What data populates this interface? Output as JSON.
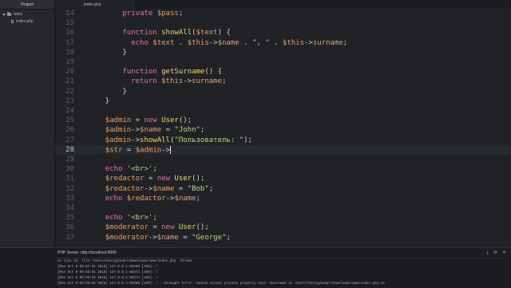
{
  "sidebar": {
    "title": "Project",
    "items": [
      {
        "label": "www",
        "type": "folder"
      },
      {
        "label": "index.php",
        "type": "file"
      }
    ]
  },
  "tabs": [
    {
      "label": "index.php"
    }
  ],
  "editor": {
    "current_line": 28,
    "lines": [
      {
        "num": "14",
        "tokens": [
          [
            "        ",
            "op"
          ],
          [
            "private",
            "kw"
          ],
          [
            " ",
            "op"
          ],
          [
            "$pass",
            "var"
          ],
          [
            ";",
            "op"
          ]
        ]
      },
      {
        "num": "15",
        "tokens": []
      },
      {
        "num": "16",
        "tokens": [
          [
            "        ",
            "op"
          ],
          [
            "function",
            "kw"
          ],
          [
            " ",
            "op"
          ],
          [
            "showAll",
            "fn"
          ],
          [
            "(",
            "op"
          ],
          [
            "$text",
            "var"
          ],
          [
            ") {",
            "op"
          ]
        ]
      },
      {
        "num": "17",
        "tokens": [
          [
            "          ",
            "op"
          ],
          [
            "echo",
            "kw"
          ],
          [
            " ",
            "op"
          ],
          [
            "$text",
            "var"
          ],
          [
            " . ",
            "op"
          ],
          [
            "$this",
            "var"
          ],
          [
            "->",
            "op"
          ],
          [
            "$name",
            "var"
          ],
          [
            " . ",
            "op"
          ],
          [
            "\", \"",
            "str"
          ],
          [
            " . ",
            "op"
          ],
          [
            "$this",
            "var"
          ],
          [
            "->",
            "op"
          ],
          [
            "surname",
            "var"
          ],
          [
            ";",
            "op"
          ]
        ]
      },
      {
        "num": "18",
        "tokens": [
          [
            "        }",
            "op"
          ]
        ]
      },
      {
        "num": "19",
        "tokens": []
      },
      {
        "num": "20",
        "tokens": [
          [
            "        ",
            "op"
          ],
          [
            "function",
            "kw"
          ],
          [
            " ",
            "op"
          ],
          [
            "getSurname",
            "fn"
          ],
          [
            "() {",
            "op"
          ]
        ]
      },
      {
        "num": "21",
        "tokens": [
          [
            "          ",
            "op"
          ],
          [
            "return",
            "kw"
          ],
          [
            " ",
            "op"
          ],
          [
            "$this",
            "var"
          ],
          [
            "->",
            "op"
          ],
          [
            "surname",
            "var"
          ],
          [
            ";",
            "op"
          ]
        ]
      },
      {
        "num": "22",
        "tokens": [
          [
            "        }",
            "op"
          ]
        ]
      },
      {
        "num": "23",
        "tokens": [
          [
            "    }",
            "op"
          ]
        ]
      },
      {
        "num": "24",
        "tokens": []
      },
      {
        "num": "25",
        "tokens": [
          [
            "    ",
            "op"
          ],
          [
            "$admin",
            "var"
          ],
          [
            " = ",
            "op"
          ],
          [
            "new",
            "kw"
          ],
          [
            " ",
            "op"
          ],
          [
            "User",
            "fn"
          ],
          [
            "();",
            "op"
          ]
        ]
      },
      {
        "num": "26",
        "tokens": [
          [
            "    ",
            "op"
          ],
          [
            "$admin",
            "var"
          ],
          [
            "->",
            "op"
          ],
          [
            "$name",
            "var"
          ],
          [
            " = ",
            "op"
          ],
          [
            "\"John\"",
            "str"
          ],
          [
            ";",
            "op"
          ]
        ]
      },
      {
        "num": "27",
        "tokens": [
          [
            "    ",
            "op"
          ],
          [
            "$admin",
            "var"
          ],
          [
            "->",
            "op"
          ],
          [
            "showAll",
            "fn"
          ],
          [
            "(",
            "op"
          ],
          [
            "\"Пользователь: \"",
            "str"
          ],
          [
            ");",
            "op"
          ]
        ]
      },
      {
        "num": "28",
        "tokens": [
          [
            "    ",
            "op"
          ],
          [
            "$str",
            "var"
          ],
          [
            " = ",
            "op"
          ],
          [
            "$admin",
            "var"
          ],
          [
            "->",
            "op"
          ]
        ],
        "cursor": true
      },
      {
        "num": "29",
        "tokens": []
      },
      {
        "num": "30",
        "tokens": [
          [
            "    ",
            "op"
          ],
          [
            "echo",
            "kw"
          ],
          [
            " ",
            "op"
          ],
          [
            "'<br>'",
            "str"
          ],
          [
            ";",
            "op"
          ]
        ]
      },
      {
        "num": "31",
        "tokens": [
          [
            "    ",
            "op"
          ],
          [
            "$redactor",
            "var"
          ],
          [
            " = ",
            "op"
          ],
          [
            "new",
            "kw"
          ],
          [
            " ",
            "op"
          ],
          [
            "User",
            "fn"
          ],
          [
            "();",
            "op"
          ]
        ]
      },
      {
        "num": "32",
        "tokens": [
          [
            "    ",
            "op"
          ],
          [
            "$redactor",
            "var"
          ],
          [
            "->",
            "op"
          ],
          [
            "$name",
            "var"
          ],
          [
            " = ",
            "op"
          ],
          [
            "\"Bob\"",
            "str"
          ],
          [
            ";",
            "op"
          ]
        ]
      },
      {
        "num": "33",
        "tokens": [
          [
            "    ",
            "op"
          ],
          [
            "echo",
            "kw"
          ],
          [
            " ",
            "op"
          ],
          [
            "$redactor",
            "var"
          ],
          [
            "->",
            "op"
          ],
          [
            "$name",
            "var"
          ],
          [
            ";",
            "op"
          ]
        ]
      },
      {
        "num": "34",
        "tokens": []
      },
      {
        "num": "35",
        "tokens": [
          [
            "    ",
            "op"
          ],
          [
            "echo",
            "kw"
          ],
          [
            " ",
            "op"
          ],
          [
            "'<br>'",
            "str"
          ],
          [
            ";",
            "op"
          ]
        ]
      },
      {
        "num": "36",
        "tokens": [
          [
            "    ",
            "op"
          ],
          [
            "$moderator",
            "var"
          ],
          [
            " = ",
            "op"
          ],
          [
            "new",
            "kw"
          ],
          [
            " ",
            "op"
          ],
          [
            "User",
            "fn"
          ],
          [
            "();",
            "op"
          ]
        ]
      },
      {
        "num": "37",
        "tokens": [
          [
            "    ",
            "op"
          ],
          [
            "$moderator",
            "var"
          ],
          [
            "->",
            "op"
          ],
          [
            "$name",
            "var"
          ],
          [
            " = ",
            "op"
          ],
          [
            "\"George\"",
            "str"
          ],
          [
            ";",
            "op"
          ]
        ]
      }
    ]
  },
  "panel": {
    "title": "PHP Server: http://localhost:8000",
    "logs": [
      "at line 23, file /Users/GeorgyDudar/Downloads/www/index.php  thrown",
      "[Mon Oct 8 09:57:31 2018] 127.0.0.1:58269 [200]: /",
      "[Mon Oct 8 09:58:01 2018] 127.0.0.1:58272 [200]: /",
      "[Mon Oct 8 09:58:26 2018] 127.0.0.1:58274 [200]: /",
      "[Mon Oct 8 09:58:55 2018] 127.0.0.1:58280 [200]: / - Uncaught Error: Cannot access private property User::$surname in /Users/GeorgyDudar/Downloads/www/index.php:23"
    ]
  }
}
